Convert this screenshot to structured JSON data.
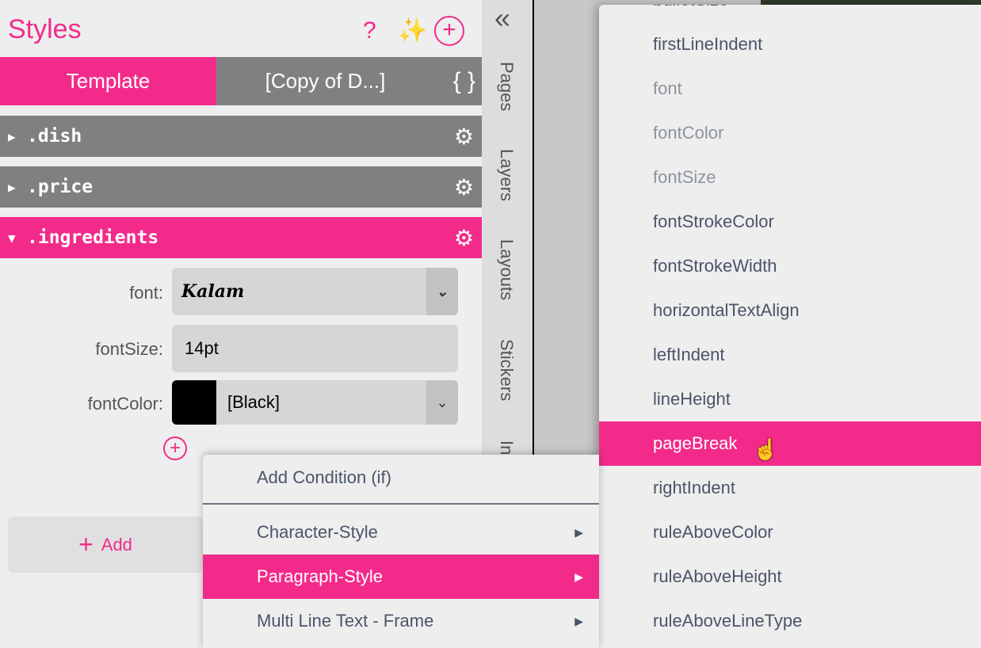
{
  "header": {
    "title": "Styles"
  },
  "tabs": [
    {
      "label": "Template"
    },
    {
      "label": "[Copy of D...]"
    }
  ],
  "braces": "{ }",
  "styles": [
    {
      "name": ".dish",
      "expanded": false
    },
    {
      "name": ".price",
      "expanded": false
    },
    {
      "name": ".ingredients",
      "expanded": true
    }
  ],
  "props": {
    "font_label": "font:",
    "font_value": "Kalam",
    "size_label": "fontSize:",
    "size_value": "14pt",
    "color_label": "fontColor:",
    "color_value": "[Black]",
    "color_swatch": "#000000"
  },
  "add_label": "Add",
  "sidebar": {
    "collapse": "«",
    "tabs": [
      "Pages",
      "Layers",
      "Layouts",
      "Stickers",
      "In"
    ]
  },
  "context_menu": {
    "items": [
      "Add Condition (if)",
      "Character-Style",
      "Paragraph-Style",
      "Multi Line Text - Frame"
    ],
    "highlighted": "Paragraph-Style"
  },
  "submenu": {
    "items": [
      "bulletSize",
      "firstLineIndent",
      "font",
      "fontColor",
      "fontSize",
      "fontStrokeColor",
      "fontStrokeWidth",
      "horizontalTextAlign",
      "leftIndent",
      "lineHeight",
      "pageBreak",
      "rightIndent",
      "ruleAboveColor",
      "ruleAboveHeight",
      "ruleAboveLineType"
    ],
    "disabled": [
      "font",
      "fontColor",
      "fontSize"
    ],
    "highlighted": "pageBreak"
  },
  "colors": {
    "accent": "#f22b8a",
    "row": "#808080"
  }
}
